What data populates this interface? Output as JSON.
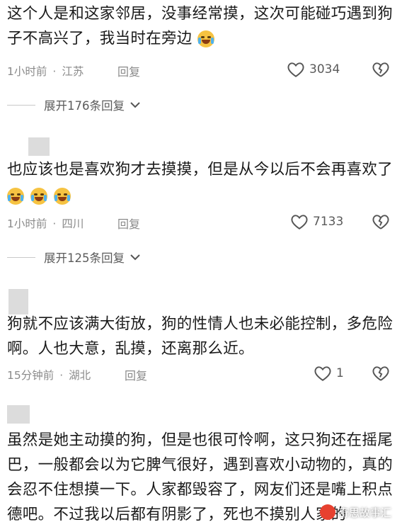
{
  "comments": [
    {
      "lines": [
        "这个人是和这家邻居，没事经常摸，这次可能碰巧遇到狗",
        "子不高兴了，我当时在旁边"
      ],
      "time": "1小时前",
      "location": "江苏",
      "reply_label": "回复",
      "likes": "3034",
      "expand_label": "展开176条回复"
    },
    {
      "lines": [
        "也应该也是喜欢狗才去摸摸，但是从今以后不会再喜欢了"
      ],
      "time": "1小时前",
      "location": "四川",
      "reply_label": "回复",
      "likes": "7133",
      "expand_label": "展开125条回复"
    },
    {
      "lines": [
        "狗就不应该满大街放，狗的性情人也未必能控制，多危险",
        "啊。人也大意，乱摸，还离那么近。"
      ],
      "time": "15分钟前",
      "location": "湖北",
      "reply_label": "回复",
      "likes": "1"
    },
    {
      "lines": [
        "虽然是她主动摸的狗，但是也很可怜啊，这只狗还在摇尾",
        "巴，一般都会以为它脾气很好，遇到喜欢小动物的，真的",
        "会忍不住想摸一下。人家都毁容了，网友们还是嘴上积点",
        "德吧。不过我以后都有阴影了，死也不摸别人家的"
      ]
    }
  ],
  "watermark": "奇思故事汇",
  "icons": {
    "like": "heart-outline-icon",
    "dislike": "broken-heart-icon",
    "expand": "chevron-down-icon",
    "emoji": "laughing-tears-emoji"
  },
  "colors": {
    "text": "#1a1a1a",
    "meta": "#8a8a8a"
  }
}
